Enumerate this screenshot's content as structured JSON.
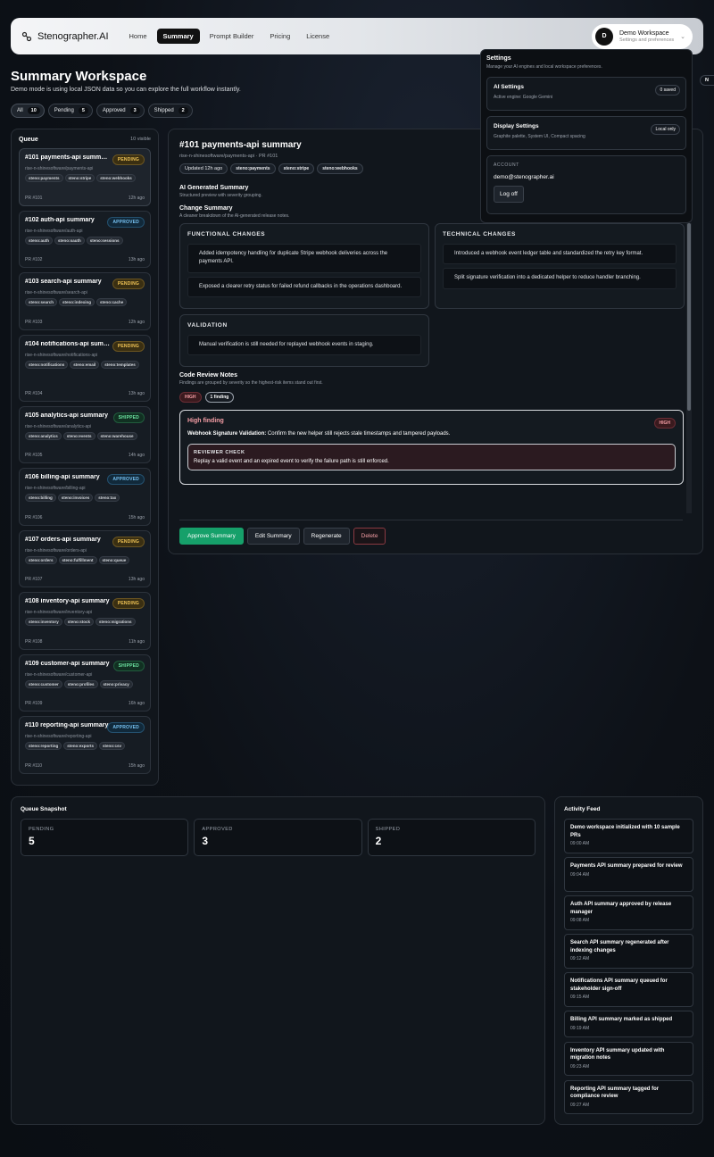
{
  "nav": {
    "brand": "Stenographer.AI",
    "links": [
      "Home",
      "Summary",
      "Prompt Builder",
      "Pricing",
      "License"
    ],
    "workspace_initial": "D",
    "workspace_name": "Demo Workspace",
    "workspace_sub": "Settings and preferences"
  },
  "header": {
    "title": "Summary Workspace",
    "subtitle": "Demo mode is using local JSON data so you can explore the full workflow instantly.",
    "partial_pill": "N",
    "filters": [
      {
        "label": "All",
        "count": "10"
      },
      {
        "label": "Pending",
        "count": "5"
      },
      {
        "label": "Approved",
        "count": "3"
      },
      {
        "label": "Shipped",
        "count": "2"
      }
    ]
  },
  "queue": {
    "title": "Queue",
    "count": "10 visible",
    "items": [
      {
        "title": "#101 payments-api summary",
        "status": "PENDING",
        "repo": "rise-n-shinesoftware/payments-api",
        "tags": [
          "steno:payments",
          "steno:stripe",
          "steno:webhooks"
        ],
        "pr": "PR #101",
        "time": "12h ago"
      },
      {
        "title": "#102 auth-api summary",
        "status": "APPROVED",
        "repo": "rise-n-shinesoftware/auth-api",
        "tags": [
          "steno:auth",
          "steno:oauth",
          "steno:sessions"
        ],
        "pr": "PR #102",
        "time": "13h ago"
      },
      {
        "title": "#103 search-api summary",
        "status": "PENDING",
        "repo": "rise-n-shinesoftware/search-api",
        "tags": [
          "steno:search",
          "steno:indexing",
          "steno:cache"
        ],
        "pr": "PR #103",
        "time": "12h ago"
      },
      {
        "title": "#104 notifications-api summary",
        "status": "PENDING",
        "repo": "rise-n-shinesoftware/notifications-api",
        "tags": [
          "steno:notifications",
          "steno:email",
          "steno:templates"
        ],
        "pr": "PR #104",
        "time": "13h ago"
      },
      {
        "title": "#105 analytics-api summary",
        "status": "SHIPPED",
        "repo": "rise-n-shinesoftware/analytics-api",
        "tags": [
          "steno:analytics",
          "steno:events",
          "steno:warehouse"
        ],
        "pr": "PR #105",
        "time": "14h ago"
      },
      {
        "title": "#106 billing-api summary",
        "status": "APPROVED",
        "repo": "rise-n-shinesoftware/billing-api",
        "tags": [
          "steno:billing",
          "steno:invoices",
          "steno:tax"
        ],
        "pr": "PR #106",
        "time": "15h ago"
      },
      {
        "title": "#107 orders-api summary",
        "status": "PENDING",
        "repo": "rise-n-shinesoftware/orders-api",
        "tags": [
          "steno:orders",
          "steno:fulfillment",
          "steno:queue"
        ],
        "pr": "PR #107",
        "time": "13h ago"
      },
      {
        "title": "#108 inventory-api summary",
        "status": "PENDING",
        "repo": "rise-n-shinesoftware/inventory-api",
        "tags": [
          "steno:inventory",
          "steno:stock",
          "steno:migrations"
        ],
        "pr": "PR #108",
        "time": "11h ago"
      },
      {
        "title": "#109 customer-api summary",
        "status": "SHIPPED",
        "repo": "rise-n-shinesoftware/customer-api",
        "tags": [
          "steno:customer",
          "steno:profiles",
          "steno:privacy"
        ],
        "pr": "PR #109",
        "time": "16h ago"
      },
      {
        "title": "#110 reporting-api summary",
        "status": "APPROVED",
        "repo": "rise-n-shinesoftware/reporting-api",
        "tags": [
          "steno:reporting",
          "steno:exports",
          "steno:csv"
        ],
        "pr": "PR #110",
        "time": "15h ago"
      }
    ]
  },
  "detail": {
    "title": "#101 payments-api summary",
    "repo": "rise-n-shinesoftware/payments-api · PR #101",
    "updated": "Updated 12h ago",
    "tags": [
      "steno:payments",
      "steno:stripe",
      "steno:webhooks"
    ],
    "ai_title": "AI Generated Summary",
    "ai_sub": "Structured preview with severity grouping.",
    "change_title": "Change Summary",
    "change_sub": "A cleaner breakdown of the AI-generated release notes.",
    "functional_head": "FUNCTIONAL CHANGES",
    "functional": [
      "Added idempotency handling for duplicate Stripe webhook deliveries across the payments API.",
      "Exposed a clearer retry status for failed refund callbacks in the operations dashboard."
    ],
    "technical_head": "TECHNICAL CHANGES",
    "technical": [
      "Introduced a webhook event ledger table and standardized the retry key format.",
      "Split signature verification into a dedicated helper to reduce handler branching."
    ],
    "validation_head": "VALIDATION",
    "validation": [
      "Manual verification is still needed for replayed webhook events in staging."
    ],
    "review_title": "Code Review Notes",
    "review_sub": "Findings are grouped by severity so the highest-risk items stand out first.",
    "sev_label": "HIGH",
    "sev_count": "1 finding",
    "finding_title": "High finding",
    "finding_badge": "HIGH",
    "finding_bold": "Webhook Signature Validation:",
    "finding_text": " Confirm the new helper still rejects stale timestamps and tampered payloads.",
    "reviewer_head": "REVIEWER CHECK",
    "reviewer_text": "Replay a valid event and an expired event to verify the failure path is still enforced.",
    "actions": {
      "approve": "Approve Summary",
      "edit": "Edit Summary",
      "regenerate": "Regenerate",
      "delete": "Delete"
    }
  },
  "dropdown": {
    "title": "Settings",
    "sub": "Manage your AI engines and local workspace preferences.",
    "ai_title": "AI Settings",
    "ai_sub": "Active engine: Google Gemini",
    "ai_pill": "0 saved",
    "display_title": "Display Settings",
    "display_sub": "Graphite palette, System UI, Compact spacing",
    "display_pill": "Local only",
    "account_label": "ACCOUNT",
    "email": "demo@stenographer.ai",
    "logoff": "Log off"
  },
  "snapshot": {
    "title": "Queue Snapshot",
    "cards": [
      {
        "label": "PENDING",
        "value": "5"
      },
      {
        "label": "APPROVED",
        "value": "3"
      },
      {
        "label": "SHIPPED",
        "value": "2"
      }
    ]
  },
  "activity": {
    "title": "Activity Feed",
    "items": [
      {
        "text": "Demo workspace initialized with 10 sample PRs",
        "time": "09:00 AM"
      },
      {
        "text": "Payments API summary prepared for review",
        "time": "09:04 AM"
      },
      {
        "text": "Auth API summary approved by release manager",
        "time": "09:08 AM"
      },
      {
        "text": "Search API summary regenerated after indexing changes",
        "time": "09:12 AM"
      },
      {
        "text": "Notifications API summary queued for stakeholder sign-off",
        "time": "09:15 AM"
      },
      {
        "text": "Billing API summary marked as shipped",
        "time": "09:19 AM"
      },
      {
        "text": "Inventory API summary updated with migration notes",
        "time": "09:23 AM"
      },
      {
        "text": "Reporting API summary tagged for compliance review",
        "time": "09:27 AM"
      }
    ]
  }
}
